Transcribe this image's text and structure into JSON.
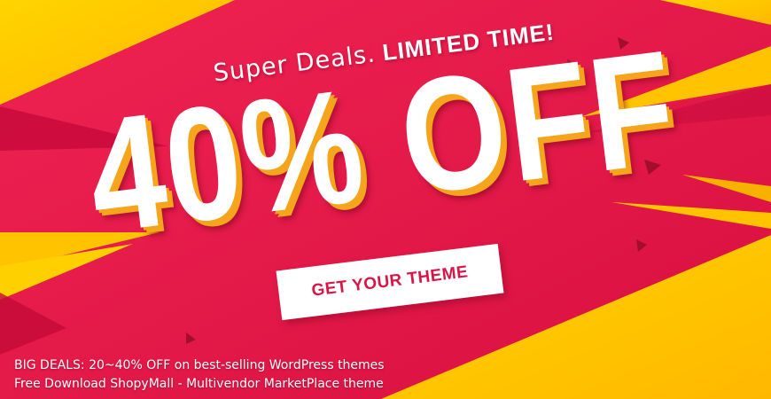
{
  "banner": {
    "tagline_light": "Super Deals.",
    "tagline_bold": "LIMITED TIME!",
    "discount": "40% OFF",
    "cta_label": "GET YOUR THEME",
    "footer_line1": "BIG DEALS: 20~40% OFF on best-selling WordPress themes",
    "footer_line2": "Free Download ShopyMall - Multivendor MarketPlace theme"
  },
  "colors": {
    "background": "#e8174a",
    "accent_yellow": "#ffd200",
    "accent_orange": "#f4a51c",
    "cta_text": "#d81546",
    "text": "#ffffff"
  }
}
